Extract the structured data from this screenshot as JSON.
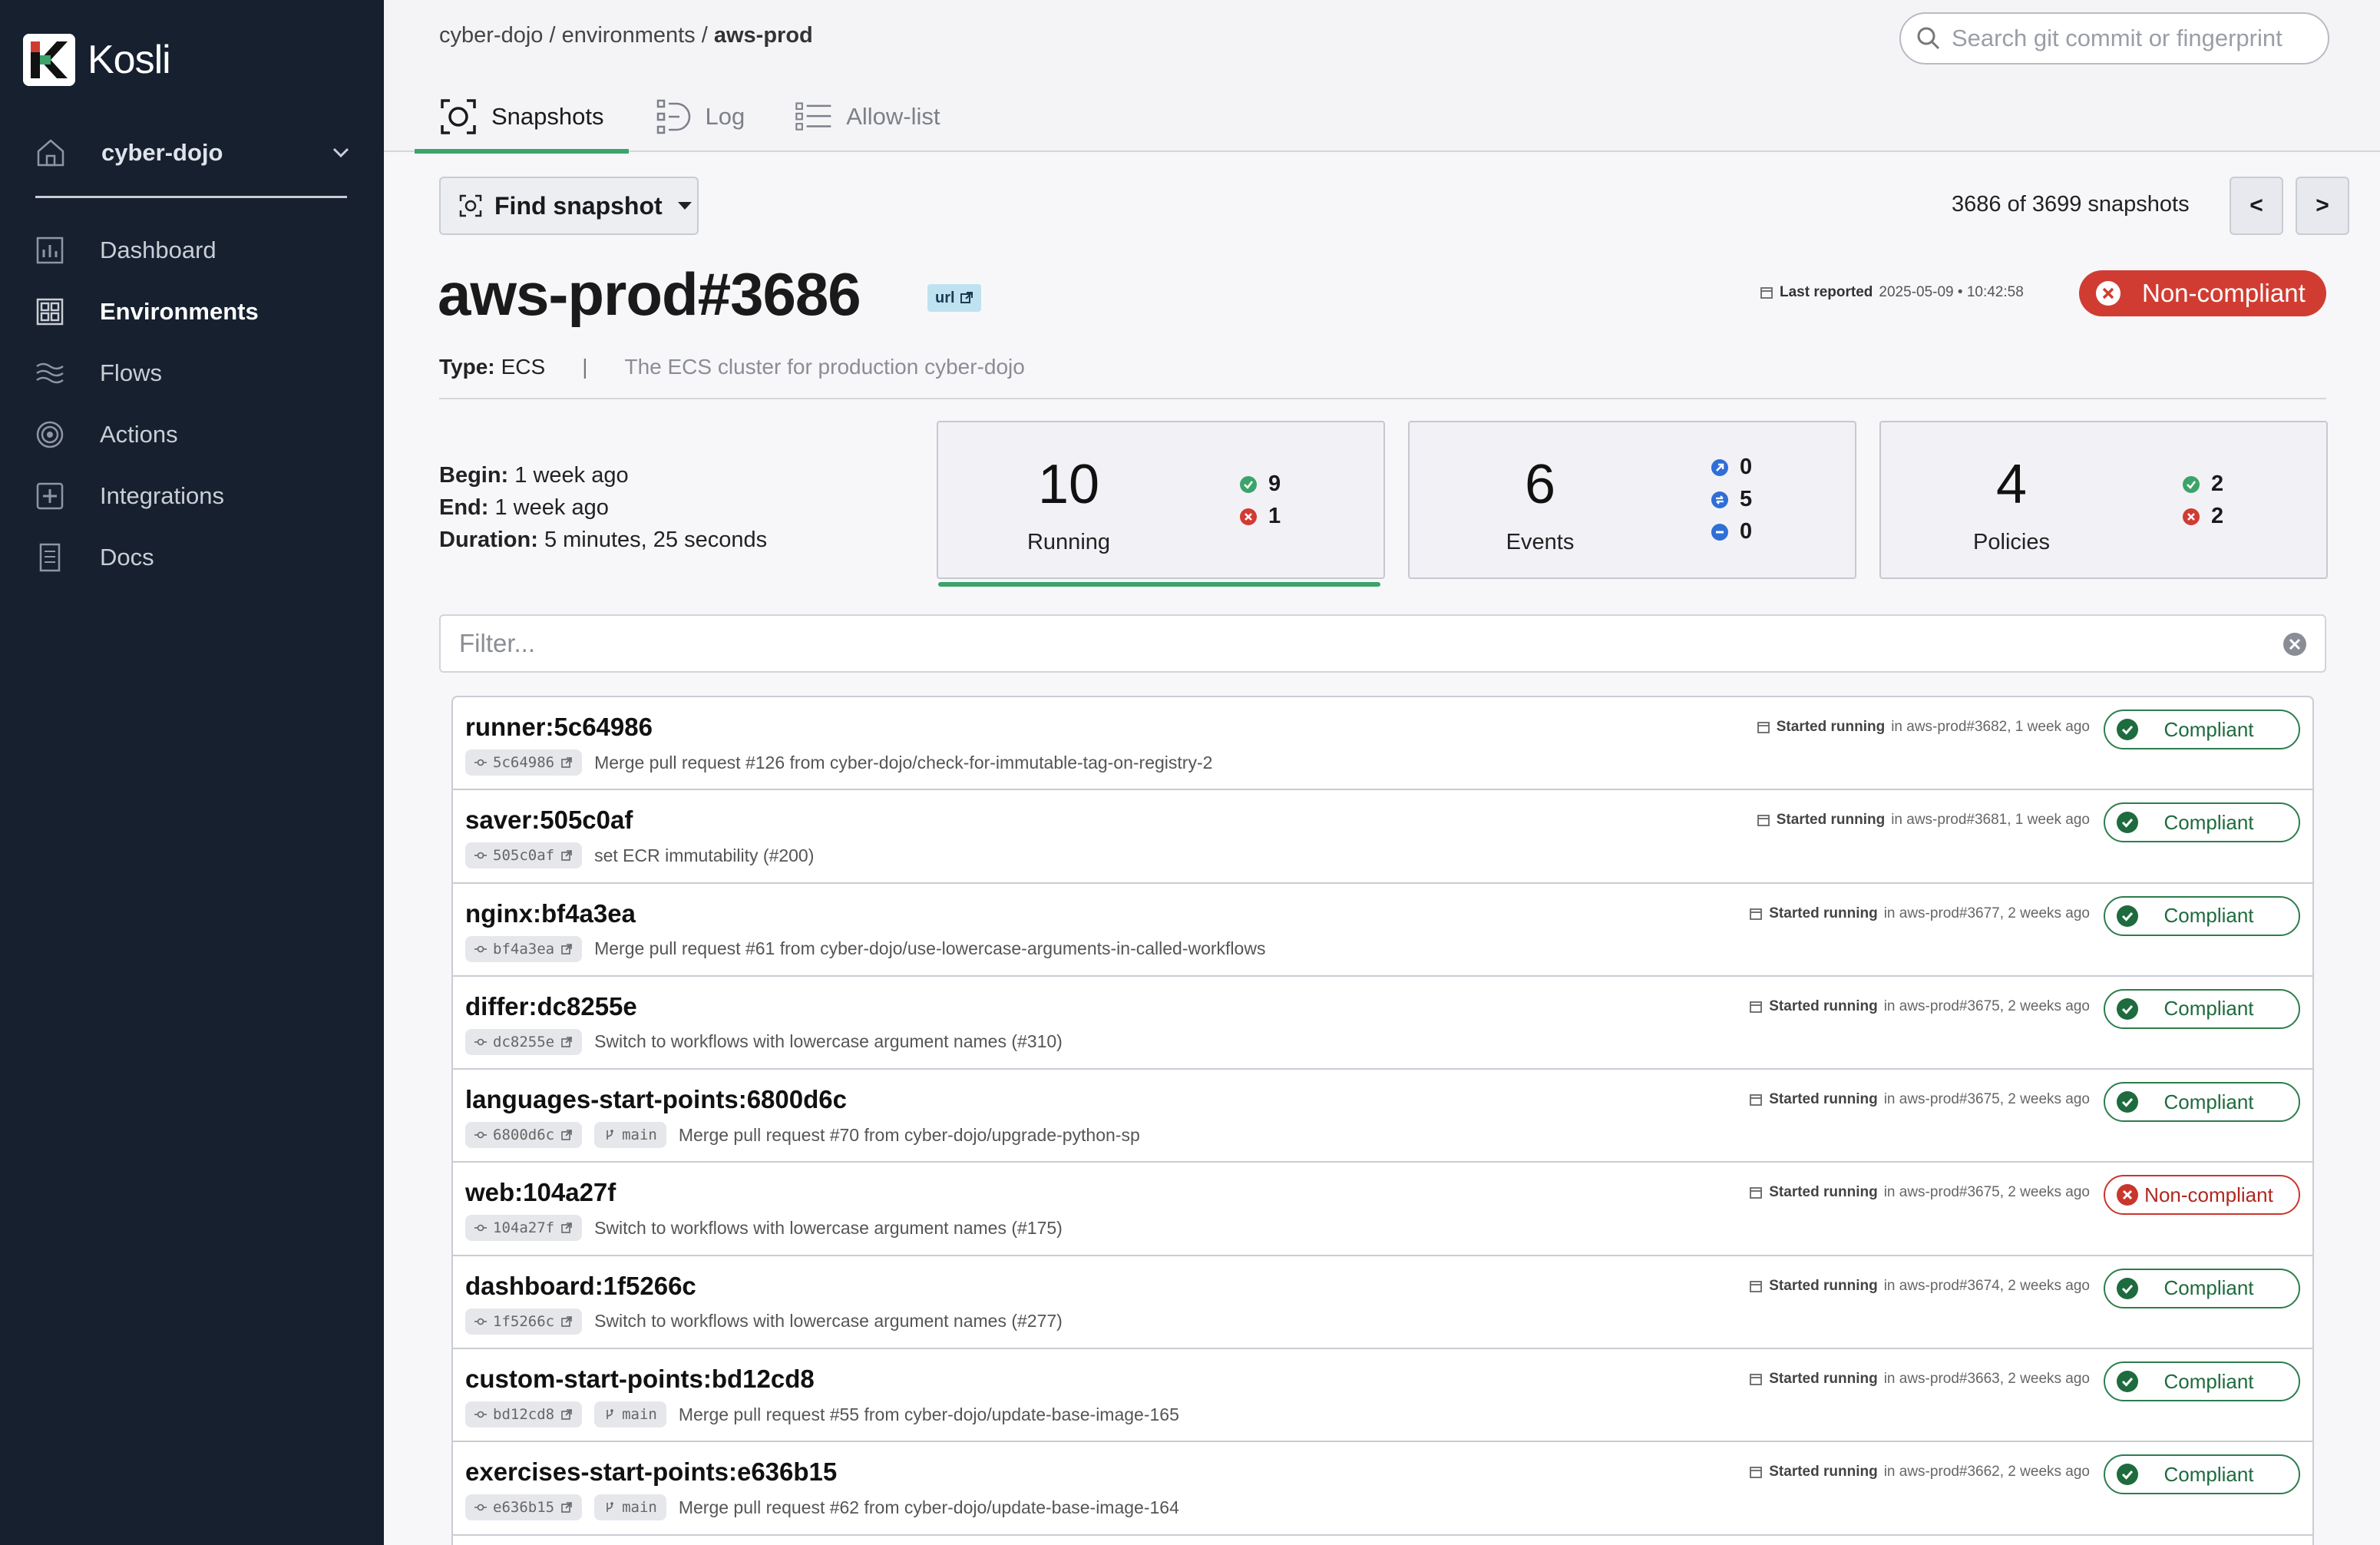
{
  "brand": {
    "name": "Kosli"
  },
  "sidebar": {
    "org": "cyber-dojo",
    "items": [
      {
        "label": "Dashboard",
        "icon": "chart-icon"
      },
      {
        "label": "Environments",
        "icon": "grid-icon",
        "active": true
      },
      {
        "label": "Flows",
        "icon": "waves-icon"
      },
      {
        "label": "Actions",
        "icon": "target-icon"
      },
      {
        "label": "Integrations",
        "icon": "plus-square-icon"
      },
      {
        "label": "Docs",
        "icon": "document-icon"
      }
    ]
  },
  "header": {
    "breadcrumb": {
      "org": "cyber-dojo",
      "sep1": " / ",
      "section": "environments",
      "sep2": " / ",
      "current": "aws-prod"
    },
    "search_placeholder": "Search git commit or fingerprint",
    "tabs": [
      {
        "label": "Snapshots",
        "active": true
      },
      {
        "label": "Log"
      },
      {
        "label": "Allow-list"
      }
    ]
  },
  "snapshot": {
    "find_label": "Find snapshot",
    "count_text": "3686 of 3699 snapshots",
    "prev_label": "<",
    "next_label": ">",
    "title": "aws-prod#3686",
    "url_label": "url",
    "last_reported_label": "Last reported",
    "last_reported_value": "2025-05-09 • 10:42:58",
    "status": "Non-compliant",
    "type_label": "Type:",
    "type_value": "ECS",
    "type_sep": "|",
    "description": "The ECS cluster for production cyber-dojo",
    "begin_label": "Begin:",
    "begin_value": "1 week ago",
    "end_label": "End:",
    "end_value": "1 week ago",
    "duration_label": "Duration:",
    "duration_value": "5 minutes, 25 seconds"
  },
  "stats": {
    "running": {
      "value": "10",
      "label": "Running",
      "ok": "9",
      "bad": "1"
    },
    "events": {
      "value": "6",
      "label": "Events",
      "a": "0",
      "b": "5",
      "c": "0"
    },
    "policies": {
      "value": "4",
      "label": "Policies",
      "ok": "2",
      "bad": "2"
    }
  },
  "filter": {
    "placeholder": "Filter..."
  },
  "colors": {
    "sidebar": "#16202e",
    "accent": "#3ca36a",
    "danger": "#d13c32"
  },
  "artifacts": [
    {
      "name": "runner:5c64986",
      "commit": "5c64986",
      "branch": "",
      "message": "Merge pull request #126 from cyber-dojo/check-for-immutable-tag-on-registry-2",
      "started_label": "Started running",
      "started_rest": "in aws-prod#3682, 1 week ago",
      "status": "Compliant"
    },
    {
      "name": "saver:505c0af",
      "commit": "505c0af",
      "branch": "",
      "message": "set ECR immutability (#200)",
      "started_label": "Started running",
      "started_rest": "in aws-prod#3681, 1 week ago",
      "status": "Compliant"
    },
    {
      "name": "nginx:bf4a3ea",
      "commit": "bf4a3ea",
      "branch": "",
      "message": "Merge pull request #61 from cyber-dojo/use-lowercase-arguments-in-called-workflows",
      "started_label": "Started running",
      "started_rest": "in aws-prod#3677, 2 weeks ago",
      "status": "Compliant"
    },
    {
      "name": "differ:dc8255e",
      "commit": "dc8255e",
      "branch": "",
      "message": "Switch to workflows with lowercase argument names (#310)",
      "started_label": "Started running",
      "started_rest": "in aws-prod#3675, 2 weeks ago",
      "status": "Compliant"
    },
    {
      "name": "languages-start-points:6800d6c",
      "commit": "6800d6c",
      "branch": "main",
      "message": "Merge pull request #70 from cyber-dojo/upgrade-python-sp",
      "started_label": "Started running",
      "started_rest": "in aws-prod#3675, 2 weeks ago",
      "status": "Compliant"
    },
    {
      "name": "web:104a27f",
      "commit": "104a27f",
      "branch": "",
      "message": "Switch to workflows with lowercase argument names (#175)",
      "started_label": "Started running",
      "started_rest": "in aws-prod#3675, 2 weeks ago",
      "status": "Non-compliant"
    },
    {
      "name": "dashboard:1f5266c",
      "commit": "1f5266c",
      "branch": "",
      "message": "Switch to workflows with lowercase argument names (#277)",
      "started_label": "Started running",
      "started_rest": "in aws-prod#3674, 2 weeks ago",
      "status": "Compliant"
    },
    {
      "name": "custom-start-points:bd12cd8",
      "commit": "bd12cd8",
      "branch": "main",
      "message": "Merge pull request #55 from cyber-dojo/update-base-image-165",
      "started_label": "Started running",
      "started_rest": "in aws-prod#3663, 2 weeks ago",
      "status": "Compliant"
    },
    {
      "name": "exercises-start-points:e636b15",
      "commit": "e636b15",
      "branch": "main",
      "message": "Merge pull request #62 from cyber-dojo/update-base-image-164",
      "started_label": "Started running",
      "started_rest": "in aws-prod#3662, 2 weeks ago",
      "status": "Compliant"
    }
  ]
}
